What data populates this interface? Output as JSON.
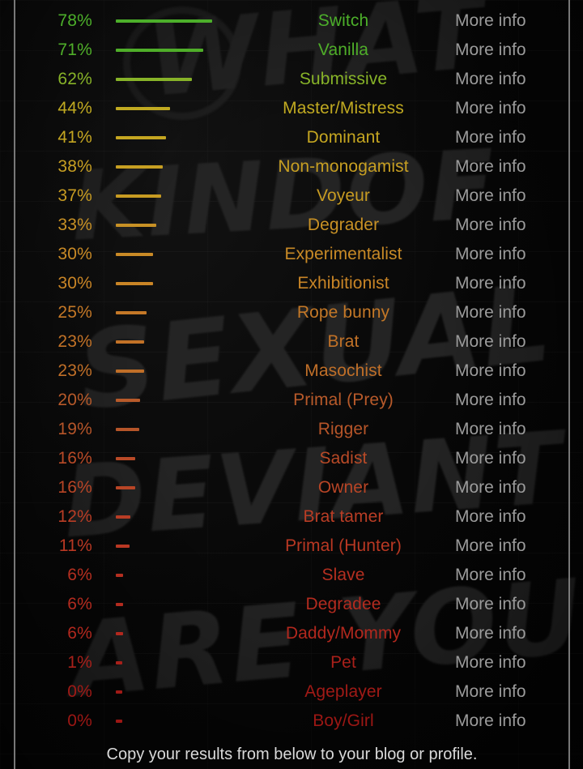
{
  "background": {
    "graffiti_words": [
      "WHAT",
      "KINDOF",
      "SEXUAL",
      "DEVIANT",
      "ARE YOU"
    ]
  },
  "columns": {
    "percent_header": "",
    "bar_header": "",
    "label_header": "",
    "action_header": ""
  },
  "action_label": "More info",
  "footer": {
    "text": "Copy your results from below to your blog or profile."
  },
  "colors": {
    "green": "#4caf2a",
    "yellow_green": "#9cb02a",
    "yellow": "#c4a81f",
    "gold": "#c79a22",
    "orange": "#c98326",
    "burnt_orange": "#c06a28",
    "red_orange": "#bb4f27",
    "red": "#b63722",
    "deep_red": "#9e2018",
    "more_info": "#9b9b9b",
    "footer_text": "#d9d9d9",
    "border": "#8c8c8c"
  },
  "chart_data": {
    "type": "bar",
    "title": "",
    "xlabel": "",
    "ylabel": "",
    "xlim": [
      0,
      100
    ],
    "grid": false,
    "legend": null,
    "orientation": "horizontal",
    "unit": "%",
    "categories": [
      "Switch",
      "Vanilla",
      "Submissive",
      "Master/Mistress",
      "Dominant",
      "Non-monogamist",
      "Voyeur",
      "Degrader",
      "Experimentalist",
      "Exhibitionist",
      "Rope bunny",
      "Brat",
      "Masochist",
      "Primal (Prey)",
      "Rigger",
      "Sadist",
      "Owner",
      "Brat tamer",
      "Primal (Hunter)",
      "Slave",
      "Degradee",
      "Daddy/Mommy",
      "Pet",
      "Ageplayer",
      "Boy/Girl"
    ],
    "values": [
      78,
      71,
      62,
      44,
      41,
      38,
      37,
      33,
      30,
      30,
      25,
      23,
      23,
      20,
      19,
      16,
      16,
      12,
      11,
      6,
      6,
      6,
      1,
      0,
      0
    ]
  },
  "rows": [
    {
      "percent": "78%",
      "value": 78,
      "label": "Switch",
      "action": "More info",
      "color": "#4caf2a"
    },
    {
      "percent": "71%",
      "value": 71,
      "label": "Vanilla",
      "action": "More info",
      "color": "#4fae29"
    },
    {
      "percent": "62%",
      "value": 62,
      "label": "Submissive",
      "action": "More info",
      "color": "#87b328"
    },
    {
      "percent": "44%",
      "value": 44,
      "label": "Master/Mistress",
      "action": "More info",
      "color": "#c1aa21"
    },
    {
      "percent": "41%",
      "value": 41,
      "label": "Dominant",
      "action": "More info",
      "color": "#c5a621"
    },
    {
      "percent": "38%",
      "value": 38,
      "label": "Non-monogamist",
      "action": "More info",
      "color": "#c79f22"
    },
    {
      "percent": "37%",
      "value": 37,
      "label": "Voyeur",
      "action": "More info",
      "color": "#c79b22"
    },
    {
      "percent": "33%",
      "value": 33,
      "label": "Degrader",
      "action": "More info",
      "color": "#c89125"
    },
    {
      "percent": "30%",
      "value": 30,
      "label": "Experimentalist",
      "action": "More info",
      "color": "#c98a26"
    },
    {
      "percent": "30%",
      "value": 30,
      "label": "Exhibitionist",
      "action": "More info",
      "color": "#c98526"
    },
    {
      "percent": "25%",
      "value": 25,
      "label": "Rope bunny",
      "action": "More info",
      "color": "#c47827"
    },
    {
      "percent": "23%",
      "value": 23,
      "label": "Brat",
      "action": "More info",
      "color": "#c27227"
    },
    {
      "percent": "23%",
      "value": 23,
      "label": "Masochist",
      "action": "More info",
      "color": "#c06f28"
    },
    {
      "percent": "20%",
      "value": 20,
      "label": "Primal (Prey)",
      "action": "More info",
      "color": "#b85a2a"
    },
    {
      "percent": "19%",
      "value": 19,
      "label": "Rigger",
      "action": "More info",
      "color": "#b65529"
    },
    {
      "percent": "16%",
      "value": 16,
      "label": "Sadist",
      "action": "More info",
      "color": "#b94a27"
    },
    {
      "percent": "16%",
      "value": 16,
      "label": "Owner",
      "action": "More info",
      "color": "#b84526"
    },
    {
      "percent": "12%",
      "value": 12,
      "label": "Brat tamer",
      "action": "More info",
      "color": "#b93d25"
    },
    {
      "percent": "11%",
      "value": 11,
      "label": "Primal (Hunter)",
      "action": "More info",
      "color": "#b93823"
    },
    {
      "percent": "6%",
      "value": 6,
      "label": "Slave",
      "action": "More info",
      "color": "#b52f20"
    },
    {
      "percent": "6%",
      "value": 6,
      "label": "Degradee",
      "action": "More info",
      "color": "#b32b1f"
    },
    {
      "percent": "6%",
      "value": 6,
      "label": "Daddy/Mommy",
      "action": "More info",
      "color": "#b2281e"
    },
    {
      "percent": "1%",
      "value": 1,
      "label": "Pet",
      "action": "More info",
      "color": "#a8201a"
    },
    {
      "percent": "0%",
      "value": 0,
      "label": "Ageplayer",
      "action": "More info",
      "color": "#a01a16"
    },
    {
      "percent": "0%",
      "value": 0,
      "label": "Boy/Girl",
      "action": "More info",
      "color": "#9c1714"
    }
  ]
}
